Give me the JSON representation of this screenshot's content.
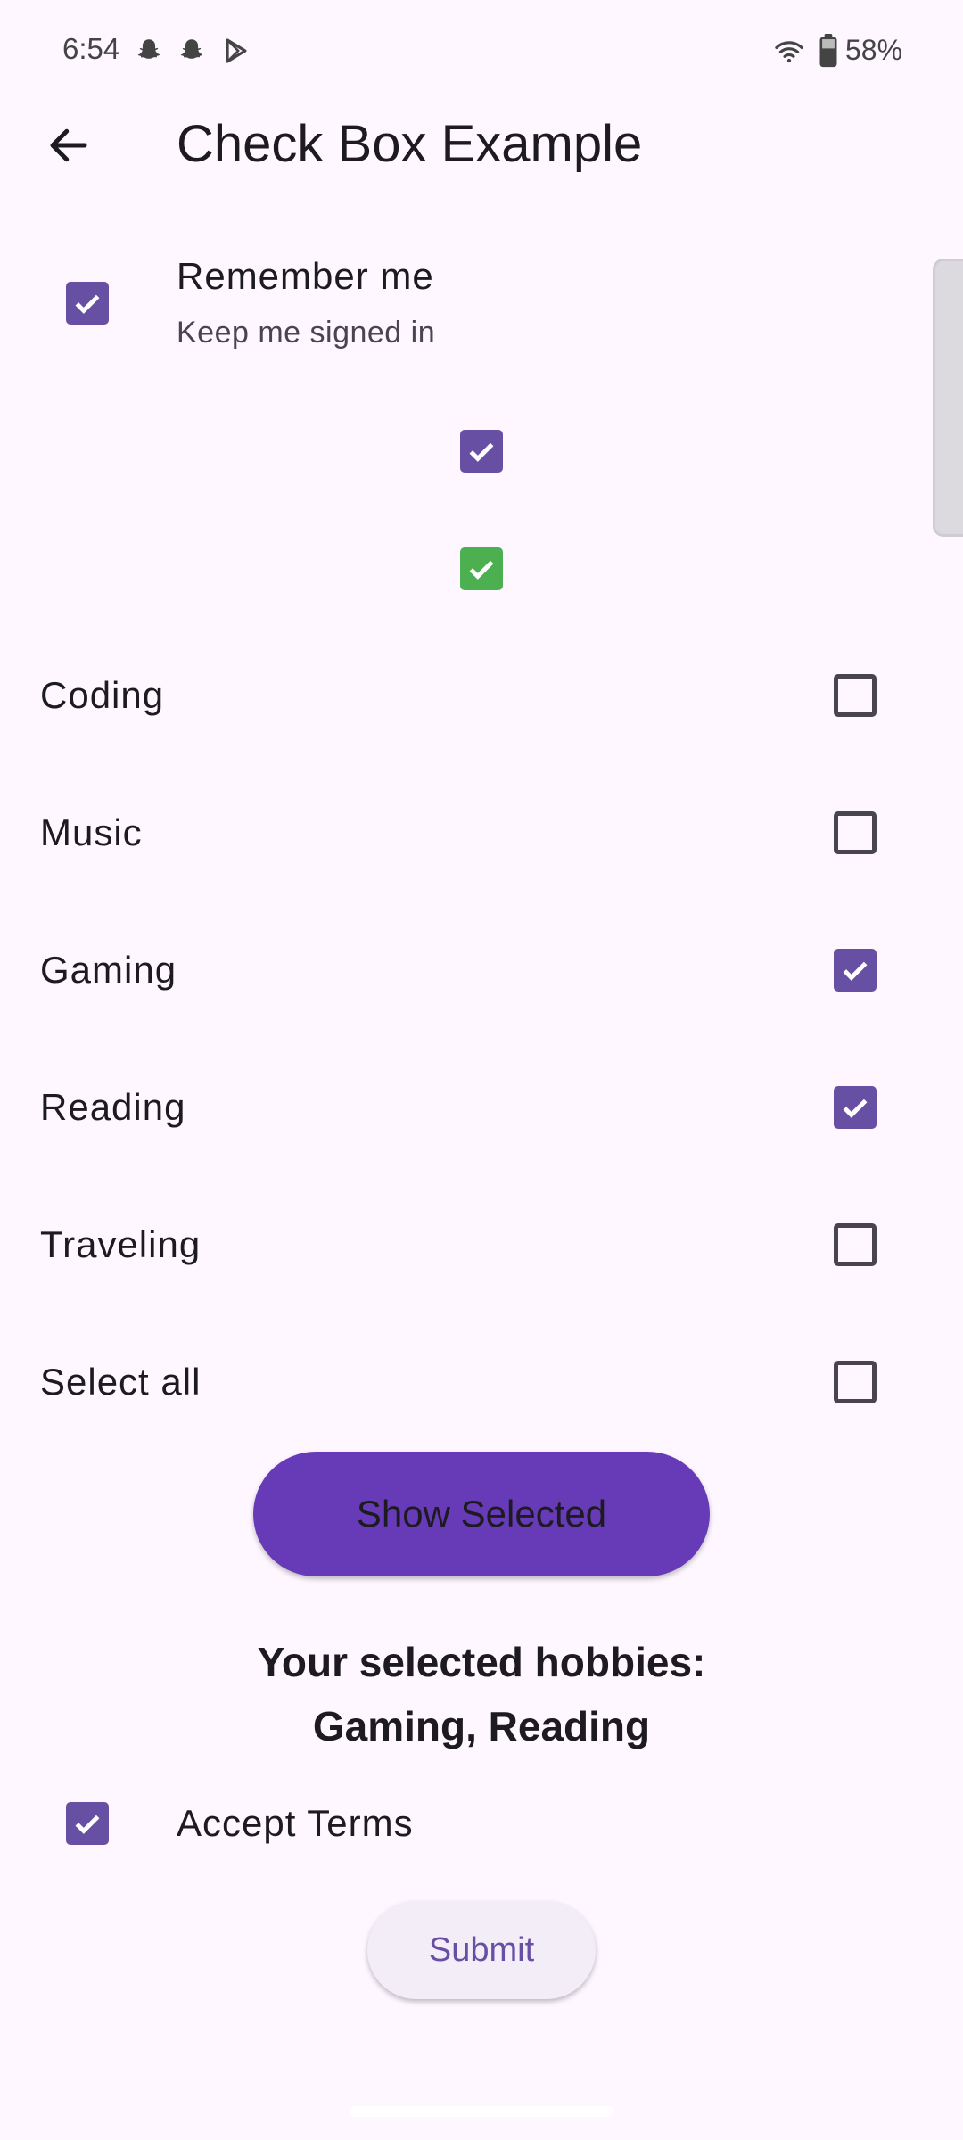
{
  "status_bar": {
    "time": "6:54",
    "battery_percent": "58%",
    "icons": [
      "snapchat-icon",
      "snapchat-icon",
      "play-store-icon",
      "wifi-icon",
      "battery-icon"
    ]
  },
  "app_bar": {
    "title": "Check Box Example",
    "back_icon": "back-arrow-icon"
  },
  "remember": {
    "title": "Remember me",
    "subtitle": "Keep me signed in",
    "checked": true
  },
  "standalone_checkboxes": [
    {
      "checked": true,
      "color": "#6750A4"
    },
    {
      "checked": true,
      "color": "#4CAF50"
    }
  ],
  "hobbies": [
    {
      "label": "Coding",
      "checked": false
    },
    {
      "label": "Music",
      "checked": false
    },
    {
      "label": "Gaming",
      "checked": true
    },
    {
      "label": "Reading",
      "checked": true
    },
    {
      "label": "Traveling",
      "checked": false
    },
    {
      "label": "Select all",
      "checked": false
    }
  ],
  "show_selected_button": "Show Selected",
  "selected_hobbies": {
    "line1": "Your selected hobbies:",
    "line2": "Gaming, Reading"
  },
  "accept_terms": {
    "label": "Accept Terms",
    "checked": true
  },
  "submit_button": "Submit",
  "colors": {
    "primary": "#6750A4",
    "primary_button": "#673AB7",
    "green_check": "#4CAF50",
    "background": "#FEF7FF"
  }
}
